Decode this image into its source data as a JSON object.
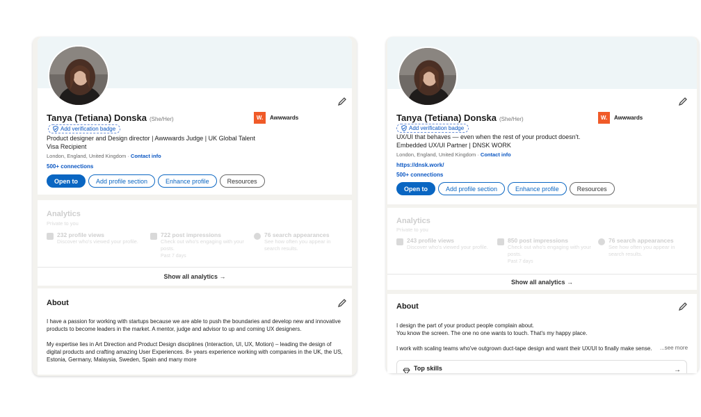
{
  "left": {
    "name": "Tanya (Tetiana) Donska",
    "pronouns": "(She/Her)",
    "verification_badge": "Add verification badge",
    "headline": "Product designer and Design director | Awwwards Judge | UK Global Talent Visa Recipient",
    "location": "London, England, United Kingdom · ",
    "contact_info": "Contact info",
    "connections": "500+ connections",
    "company": {
      "logo_text": "W.",
      "name": "Awwwards"
    },
    "buttons": {
      "open_to": "Open to",
      "add_section": "Add profile section",
      "enhance": "Enhance profile",
      "resources": "Resources"
    },
    "analytics": {
      "title": "Analytics",
      "private": "Private to you",
      "stats": [
        {
          "title": "232 profile views",
          "desc": "Discover who's viewed your profile.",
          "note": ""
        },
        {
          "title": "722 post impressions",
          "desc": "Check out who's engaging with your posts.",
          "note": "Past 7 days"
        },
        {
          "title": "76 search appearances",
          "desc": "See how often you appear in search results.",
          "note": ""
        }
      ],
      "show_all": "Show all analytics →"
    },
    "about": {
      "title": "About",
      "p1": "I have a passion for working with startups because we are able to push the boundaries and develop new and innovative products to become leaders in the market. A mentor, judge and advisor to up and coming UX designers.",
      "p2": "My expertise lies in Art Direction and Product Design disciplines (Interaction, UI, UX, Motion) – leading the design of digital products and crafting amazing User Experiences. 8+ years experience working with companies in the UK, the US, Estonia, Germany, Malaysia, Sweden, Spain and many more"
    }
  },
  "right": {
    "name": "Tanya (Tetiana) Donska",
    "pronouns": "(She/Her)",
    "verification_badge": "Add verification badge",
    "headline": "UX/UI that behaves — even when the rest of your product doesn't. Embedded UX/UI Partner | DNSK WORK",
    "location": "London, England, United Kingdom · ",
    "contact_info": "Contact info",
    "website": "https://dnsk.work/",
    "connections": "500+ connections",
    "company": {
      "logo_text": "W.",
      "name": "Awwwards"
    },
    "buttons": {
      "open_to": "Open to",
      "add_section": "Add profile section",
      "enhance": "Enhance profile",
      "resources": "Resources"
    },
    "analytics": {
      "title": "Analytics",
      "private": "Private to you",
      "stats": [
        {
          "title": "243 profile views",
          "desc": "Discover who's viewed your profile.",
          "note": ""
        },
        {
          "title": "850 post impressions",
          "desc": "Check out who's engaging with your posts.",
          "note": "Past 7 days"
        },
        {
          "title": "76 search appearances",
          "desc": "See how often you appear in search results.",
          "note": ""
        }
      ],
      "show_all": "Show all analytics →"
    },
    "about": {
      "title": "About",
      "p1": "I design the part of your product people complain about.",
      "p2": "You know the screen. The one no one wants to touch. That's my happy place.",
      "p3": "I work with scaling teams who've outgrown duct-tape design and want their UX/UI to finally make sense.",
      "see_more": "...see more",
      "top_skills": "Top skills"
    }
  },
  "colors": {
    "accent": "#0a66c2",
    "banner": "#eef5f7",
    "logo": "#f05a28"
  }
}
